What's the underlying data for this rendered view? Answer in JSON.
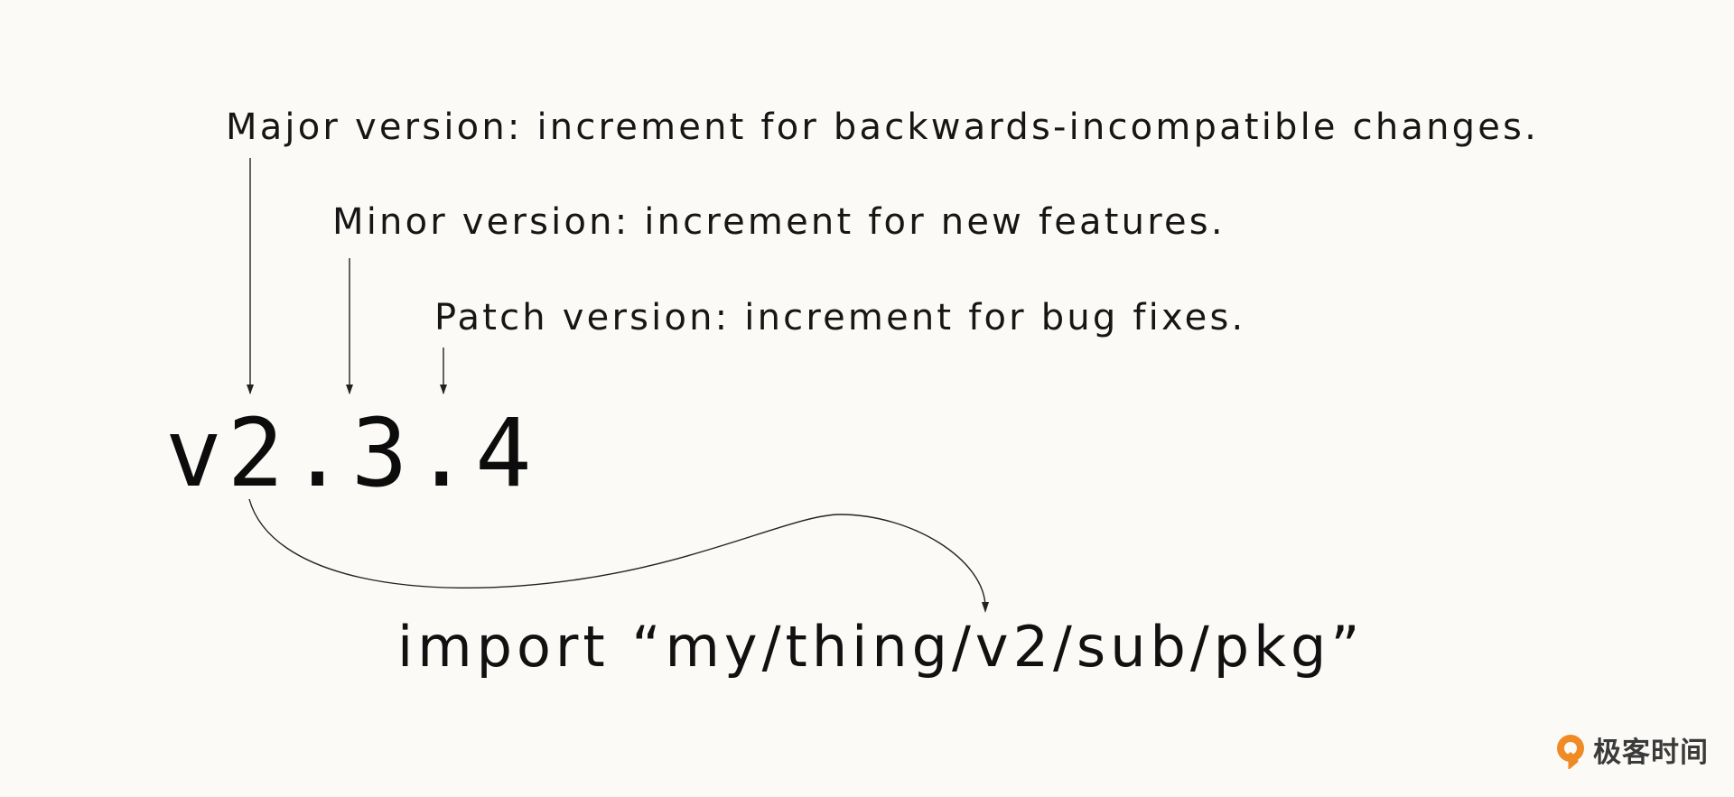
{
  "annotations": {
    "major": "Major version: increment for backwards-incompatible changes.",
    "minor": "Minor version: increment for new features.",
    "patch": "Patch version: increment for bug fixes."
  },
  "version_string": "v2.3.4",
  "import_statement": "import “my/thing/v2/sub/pkg”",
  "logo": {
    "text": "极客时间",
    "icon": "geektime-logo-icon",
    "accent": "#f08a24"
  },
  "colors": {
    "background": "#fbfaf6",
    "text": "#111111",
    "arrow": "#222222"
  }
}
